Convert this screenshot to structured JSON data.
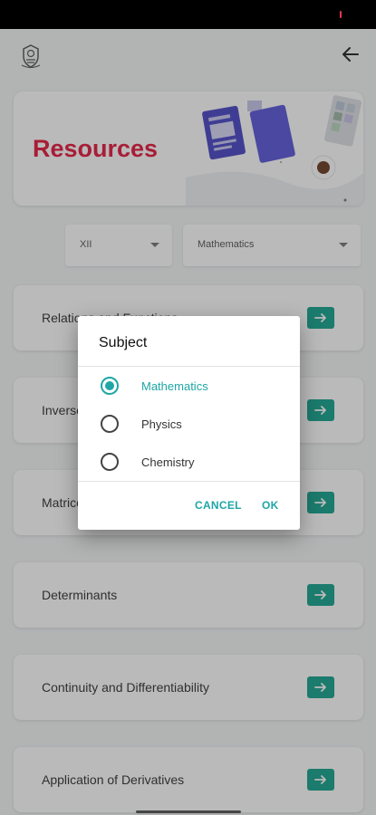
{
  "app": {
    "logo_icon": "college-crest-logo",
    "back_icon": "arrow-left-icon"
  },
  "banner": {
    "title": "Resources",
    "title_color": "#e5193d"
  },
  "filters": {
    "class_value": "XII",
    "subject_value": "Mathematics"
  },
  "chapters": [
    {
      "title": "Relations and Functions"
    },
    {
      "title": "Inverse Trigonometric Functions"
    },
    {
      "title": "Matrices"
    },
    {
      "title": "Determinants"
    },
    {
      "title": "Continuity and Differentiability"
    },
    {
      "title": "Application of Derivatives"
    }
  ],
  "dialog": {
    "title": "Subject",
    "options": [
      {
        "label": "Mathematics",
        "selected": true
      },
      {
        "label": "Physics",
        "selected": false
      },
      {
        "label": "Chemistry",
        "selected": false
      }
    ],
    "cancel_label": "CANCEL",
    "ok_label": "OK"
  },
  "colors": {
    "accent": "#1fa6a6",
    "arrow_button": "#16a38e"
  }
}
